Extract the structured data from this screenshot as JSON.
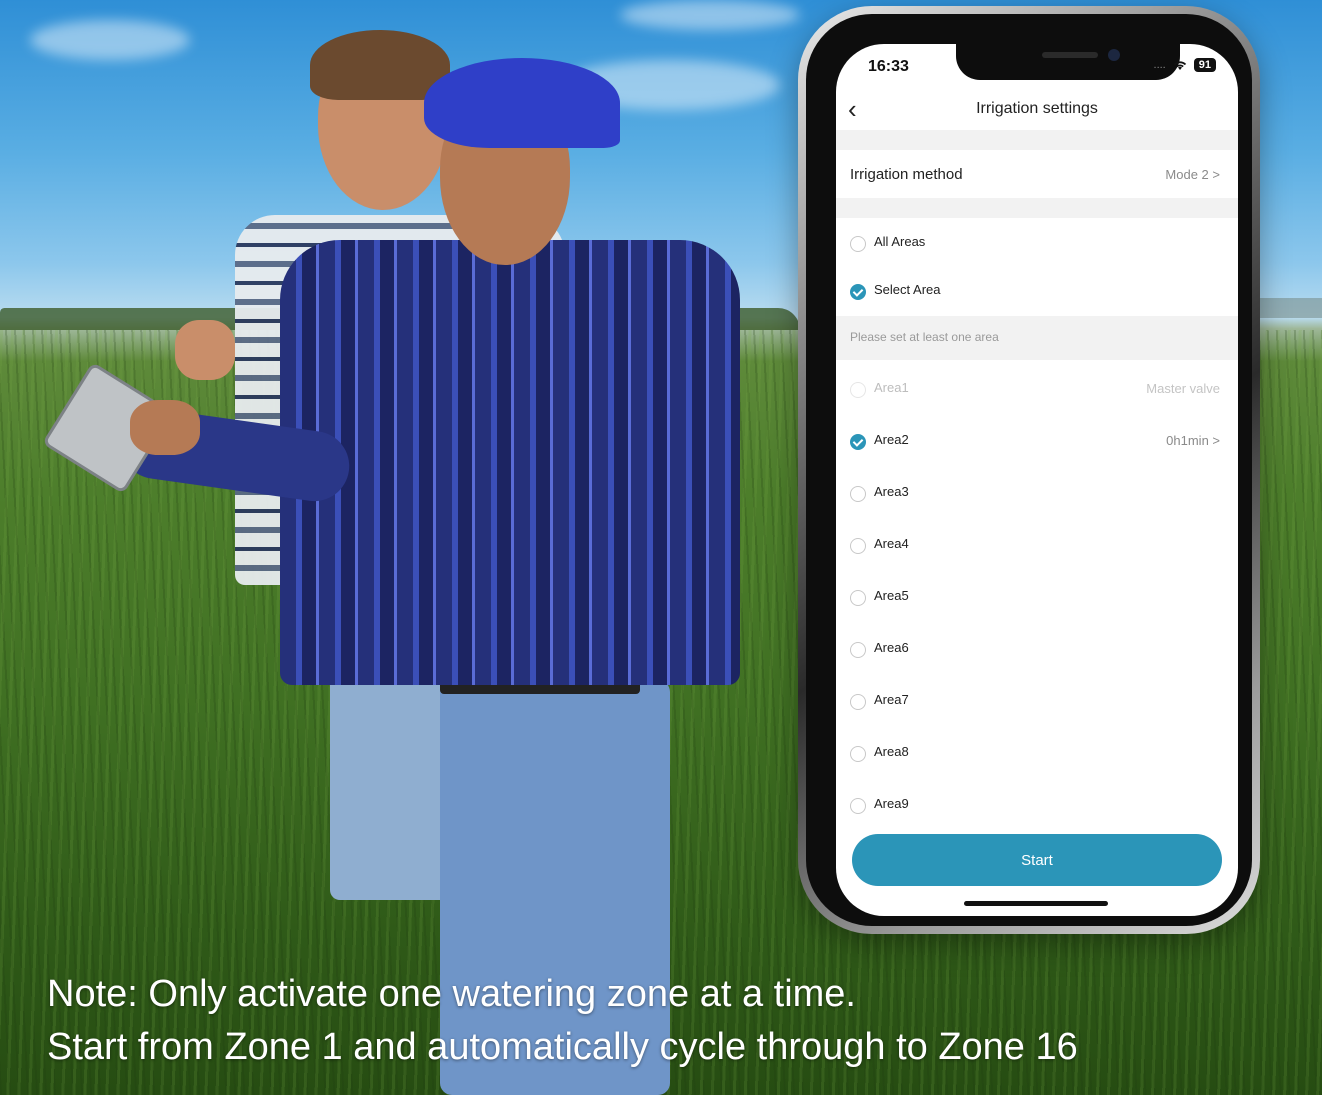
{
  "caption": {
    "line1": "Note: Only activate one watering zone at a time.",
    "line2": "Start from Zone 1 and automatically cycle through to Zone 16"
  },
  "status_bar": {
    "time": "16:33",
    "signal": "....",
    "wifi_icon": "wifi-icon",
    "battery": "91"
  },
  "navbar": {
    "back_icon": "chevron-left-icon",
    "back_glyph": "‹",
    "title": "Irrigation settings"
  },
  "irrigation_method": {
    "label": "Irrigation method",
    "value": "Mode 2 >"
  },
  "scope_options": [
    {
      "label": "All Areas",
      "checked": false
    },
    {
      "label": "Select Area",
      "checked": true
    }
  ],
  "hint": "Please set at least one area",
  "areas": [
    {
      "label": "Area1",
      "value": "Master valve",
      "checked": false,
      "disabled": true
    },
    {
      "label": "Area2",
      "value": "0h1min >",
      "checked": true,
      "disabled": false
    },
    {
      "label": "Area3",
      "value": "",
      "checked": false,
      "disabled": false
    },
    {
      "label": "Area4",
      "value": "",
      "checked": false,
      "disabled": false
    },
    {
      "label": "Area5",
      "value": "",
      "checked": false,
      "disabled": false
    },
    {
      "label": "Area6",
      "value": "",
      "checked": false,
      "disabled": false
    },
    {
      "label": "Area7",
      "value": "",
      "checked": false,
      "disabled": false
    },
    {
      "label": "Area8",
      "value": "",
      "checked": false,
      "disabled": false
    },
    {
      "label": "Area9",
      "value": "",
      "checked": false,
      "disabled": false
    }
  ],
  "start_button": "Start",
  "colors": {
    "accent": "#2b95b8",
    "divider": "#f2f2f2"
  }
}
